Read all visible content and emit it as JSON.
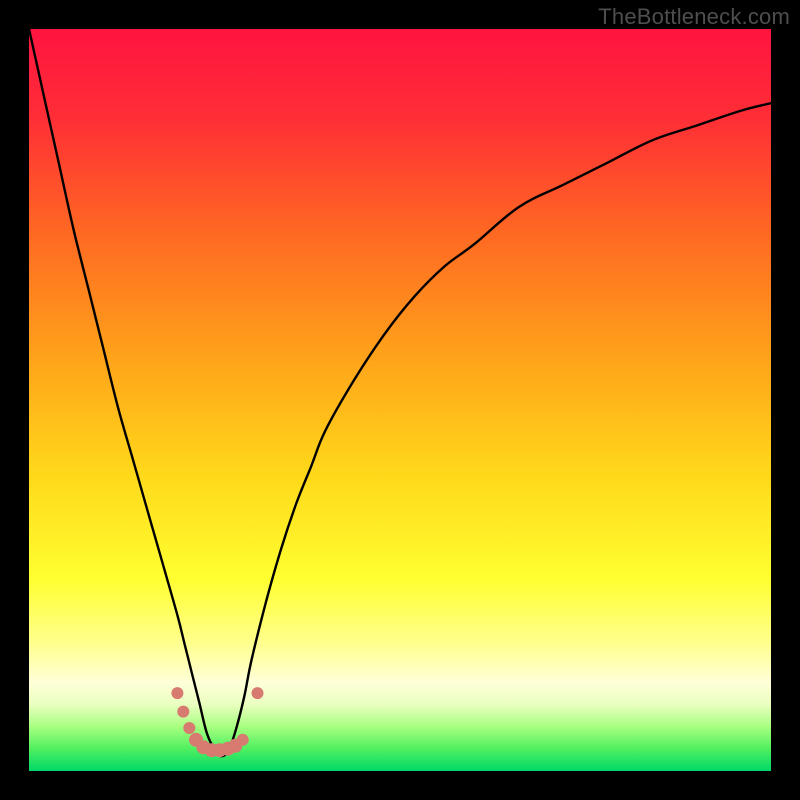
{
  "watermark": "TheBottleneck.com",
  "chart_data": {
    "type": "line",
    "title": "",
    "xlabel": "",
    "ylabel": "",
    "xlim": [
      0,
      100
    ],
    "ylim": [
      0,
      100
    ],
    "series": [
      {
        "name": "bottleneck-curve",
        "x": [
          0,
          2,
          4,
          6,
          8,
          10,
          12,
          14,
          16,
          18,
          20,
          21,
          22,
          23,
          24,
          25,
          26,
          27,
          28,
          29,
          30,
          32,
          34,
          36,
          38,
          40,
          44,
          48,
          52,
          56,
          60,
          66,
          72,
          78,
          84,
          90,
          96,
          100
        ],
        "y": [
          100,
          91,
          82,
          73,
          65,
          57,
          49,
          42,
          35,
          28,
          21,
          17,
          13,
          9,
          5,
          3,
          2,
          3,
          6,
          10,
          15,
          23,
          30,
          36,
          41,
          46,
          53,
          59,
          64,
          68,
          71,
          76,
          79,
          82,
          85,
          87,
          89,
          90
        ]
      }
    ],
    "markers": {
      "name": "highlight-dots",
      "color": "#d77a70",
      "points": [
        {
          "x": 20.0,
          "y": 10.5,
          "r": 6
        },
        {
          "x": 20.8,
          "y": 8.0,
          "r": 6
        },
        {
          "x": 21.6,
          "y": 5.8,
          "r": 6
        },
        {
          "x": 22.5,
          "y": 4.2,
          "r": 7
        },
        {
          "x": 23.5,
          "y": 3.2,
          "r": 7
        },
        {
          "x": 24.6,
          "y": 2.8,
          "r": 7
        },
        {
          "x": 25.7,
          "y": 2.8,
          "r": 7
        },
        {
          "x": 26.8,
          "y": 3.0,
          "r": 7
        },
        {
          "x": 27.8,
          "y": 3.4,
          "r": 7
        },
        {
          "x": 28.8,
          "y": 4.2,
          "r": 6
        },
        {
          "x": 30.8,
          "y": 10.5,
          "r": 6
        }
      ]
    },
    "gradient_bands": [
      {
        "y0": 100,
        "y1": 78,
        "c0": "#ff1a3e",
        "c1": "#ff5a2a"
      },
      {
        "y0": 78,
        "y1": 55,
        "c0": "#ff5a2a",
        "c1": "#ff9e1a"
      },
      {
        "y0": 55,
        "y1": 35,
        "c0": "#ff9e1a",
        "c1": "#ffe21a"
      },
      {
        "y0": 35,
        "y1": 22,
        "c0": "#ffe21a",
        "c1": "#ffff3a"
      },
      {
        "y0": 22,
        "y1": 14,
        "c0": "#ffff3a",
        "c1": "#ffffb0"
      },
      {
        "y0": 14,
        "y1": 6,
        "c0": "#ffffb0",
        "c1": "#9fff70"
      },
      {
        "y0": 6,
        "y1": 0,
        "c0": "#9fff70",
        "c1": "#00e06a"
      }
    ]
  }
}
